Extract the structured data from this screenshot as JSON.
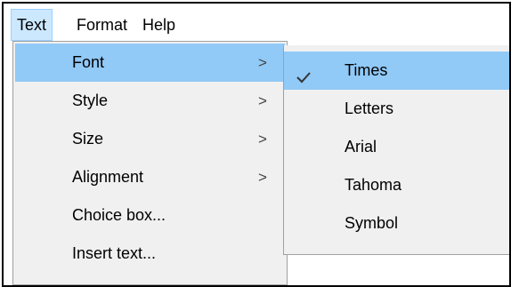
{
  "menubar": {
    "items": [
      {
        "label": "Text",
        "active": true
      },
      {
        "label": "Format",
        "active": false
      },
      {
        "label": "Help",
        "active": false
      }
    ]
  },
  "text_menu": {
    "items": [
      {
        "label": "Font",
        "has_submenu": true,
        "highlighted": true
      },
      {
        "label": "Style",
        "has_submenu": true
      },
      {
        "label": "Size",
        "has_submenu": true
      },
      {
        "label": "Alignment",
        "has_submenu": true
      },
      {
        "label": "Choice box...",
        "has_submenu": false
      },
      {
        "label": "Insert text...",
        "has_submenu": false
      }
    ],
    "submenu_arrow": ">"
  },
  "font_submenu": {
    "items": [
      {
        "label": "Times",
        "checked": true
      },
      {
        "label": "Letters",
        "checked": false
      },
      {
        "label": "Arial",
        "checked": false
      },
      {
        "label": "Tahoma",
        "checked": false
      },
      {
        "label": "Symbol",
        "checked": false
      }
    ]
  },
  "colors": {
    "highlight": "#91c9f7",
    "menu_bg": "#f0f0f0",
    "active_menubar_bg": "#cce8ff"
  }
}
